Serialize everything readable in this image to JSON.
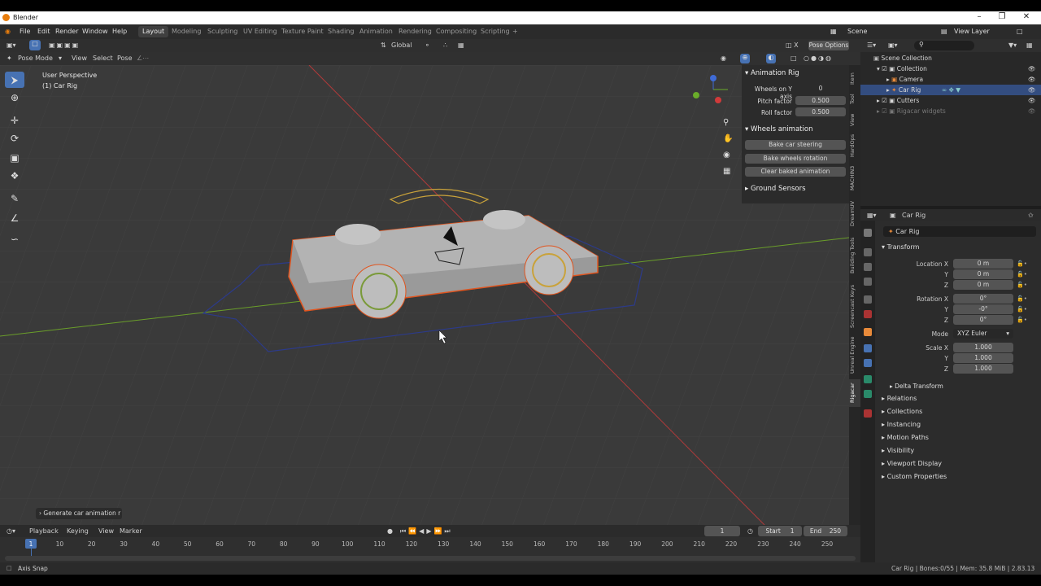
{
  "window": {
    "title": "Blender"
  },
  "menus": [
    "File",
    "Edit",
    "Render",
    "Window",
    "Help"
  ],
  "workspaces": [
    "Layout",
    "Modeling",
    "Sculpting",
    "UV Editing",
    "Texture Paint",
    "Shading",
    "Animation",
    "Rendering",
    "Compositing",
    "Scripting"
  ],
  "active_workspace": "Layout",
  "scene": "Scene",
  "view_layer": "View Layer",
  "viewport": {
    "transform_orientation": "Global",
    "pose_options": "Pose Options",
    "mode": "Pose Mode",
    "menus": [
      "View",
      "Select",
      "Pose"
    ],
    "overlay_title": "User Perspective",
    "overlay_object": "(1) Car Rig"
  },
  "npanel": {
    "animation_rig": "Animation Rig",
    "fields": [
      {
        "label": "Wheels on Y axis",
        "value": "0"
      },
      {
        "label": "Pitch factor",
        "value": "0.500"
      },
      {
        "label": "Roll factor",
        "value": "0.500"
      }
    ],
    "wheels_animation": "Wheels animation",
    "buttons": [
      "Bake car steering",
      "Bake wheels rotation",
      "Clear baked animation"
    ],
    "ground_sensors": "Ground Sensors"
  },
  "vertical_tabs": [
    "Item",
    "Tool",
    "View",
    "HardOps",
    "MACHIN3",
    "DreamUV",
    "Building Tools",
    "Screencast Keys",
    "Unreal Engine",
    "Rigacar"
  ],
  "outliner": {
    "rows": [
      {
        "label": "Scene Collection",
        "indent": 0
      },
      {
        "label": "Collection",
        "indent": 1
      },
      {
        "label": "Camera",
        "indent": 2
      },
      {
        "label": "Car Rig",
        "indent": 2
      },
      {
        "label": "Cutters",
        "indent": 1
      },
      {
        "label": "Rigacar widgets",
        "indent": 1
      }
    ]
  },
  "properties": {
    "object_name": "Car Rig",
    "object_field": "Car Rig",
    "transform": "Transform",
    "location": {
      "label": "Location X",
      "x": "0 m",
      "y": "0 m",
      "z": "0 m"
    },
    "rotation": {
      "label": "Rotation X",
      "x": "0°",
      "y": "-0°",
      "z": "0°"
    },
    "mode_label": "Mode",
    "mode_value": "XYZ Euler",
    "scale": {
      "label": "Scale X",
      "x": "1.000",
      "y": "1.000",
      "z": "1.000"
    },
    "axis_y": "Y",
    "axis_z": "Z",
    "delta_transform": "Delta Transform",
    "sections": [
      "Relations",
      "Collections",
      "Instancing",
      "Motion Paths",
      "Visibility",
      "Viewport Display",
      "Custom Properties"
    ]
  },
  "operator_panel": "Generate car animation r",
  "timeline": {
    "menus": [
      "Playback",
      "Keying",
      "View",
      "Marker"
    ],
    "current_frame": "1",
    "start_label": "Start",
    "start": "1",
    "end_label": "End",
    "end": "250",
    "ticks": [
      "1",
      "10",
      "20",
      "30",
      "40",
      "50",
      "60",
      "70",
      "80",
      "90",
      "100",
      "110",
      "120",
      "130",
      "140",
      "150",
      "160",
      "170",
      "180",
      "190",
      "200",
      "210",
      "220",
      "230",
      "240",
      "250"
    ]
  },
  "statusbar": {
    "left": "Axis Snap",
    "right": "Car Rig | Bones:0/55 | Mem: 35.8 MiB | 2.83.13"
  },
  "colors": {
    "accent": "#4772b3",
    "selection": "#e0541e",
    "xaxis": "#b03a3a",
    "yaxis": "#6a9e2a"
  }
}
